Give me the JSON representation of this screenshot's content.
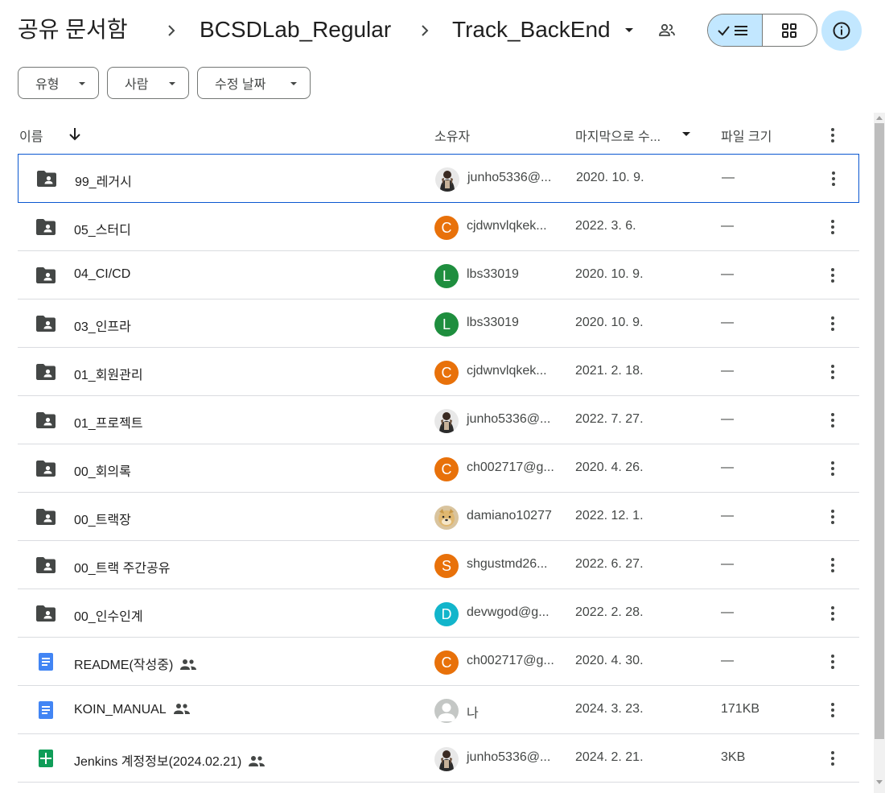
{
  "breadcrumb": {
    "root": "공유 문서함",
    "parent": "BCSDLab_Regular",
    "current": "Track_BackEnd"
  },
  "filters": [
    {
      "label": "유형"
    },
    {
      "label": "사람"
    },
    {
      "label": "수정 날짜"
    }
  ],
  "columns": {
    "name": "이름",
    "owner": "소유자",
    "modified": "마지막으로 수...",
    "size": "파일 크기"
  },
  "colors": {
    "accent": "#0b57d0",
    "toggle_active": "#c2e7ff",
    "folder_icon": "#444746",
    "doc_icon": "#4285f4",
    "sheet_icon": "#0f9d58"
  },
  "rows": [
    {
      "name": "99_레거시",
      "type": "folder",
      "shared": false,
      "owner": "junho5336@...",
      "avatar": {
        "kind": "photo-person"
      },
      "date": "2020. 10. 9.",
      "size": "—",
      "selected": true
    },
    {
      "name": "05_스터디",
      "type": "folder",
      "shared": false,
      "owner": "cjdwnvlqkek...",
      "avatar": {
        "kind": "letter",
        "letter": "C",
        "color": "#e8710a"
      },
      "date": "2022. 3. 6.",
      "size": "—"
    },
    {
      "name": "04_CI/CD",
      "type": "folder",
      "shared": false,
      "owner": "lbs33019",
      "avatar": {
        "kind": "letter",
        "letter": "L",
        "color": "#1e8e3e"
      },
      "date": "2020. 10. 9.",
      "size": "—"
    },
    {
      "name": "03_인프라",
      "type": "folder",
      "shared": false,
      "owner": "lbs33019",
      "avatar": {
        "kind": "letter",
        "letter": "L",
        "color": "#1e8e3e"
      },
      "date": "2020. 10. 9.",
      "size": "—"
    },
    {
      "name": "01_회원관리",
      "type": "folder",
      "shared": false,
      "owner": "cjdwnvlqkek...",
      "avatar": {
        "kind": "letter",
        "letter": "C",
        "color": "#e8710a"
      },
      "date": "2021. 2. 18.",
      "size": "—"
    },
    {
      "name": "01_프로젝트",
      "type": "folder",
      "shared": false,
      "owner": "junho5336@...",
      "avatar": {
        "kind": "photo-person"
      },
      "date": "2022. 7. 27.",
      "size": "—"
    },
    {
      "name": "00_회의록",
      "type": "folder",
      "shared": false,
      "owner": "ch002717@g...",
      "avatar": {
        "kind": "letter",
        "letter": "C",
        "color": "#e8710a"
      },
      "date": "2020. 4. 26.",
      "size": "—"
    },
    {
      "name": "00_트랙장",
      "type": "folder",
      "shared": false,
      "owner": "damiano10277",
      "avatar": {
        "kind": "photo-dog"
      },
      "date": "2022. 12. 1.",
      "size": "—"
    },
    {
      "name": "00_트랙 주간공유",
      "type": "folder",
      "shared": false,
      "owner": "shgustmd26...",
      "avatar": {
        "kind": "letter",
        "letter": "S",
        "color": "#e8710a"
      },
      "date": "2022. 6. 27.",
      "size": "—"
    },
    {
      "name": "00_인수인계",
      "type": "folder",
      "shared": false,
      "owner": "devwgod@g...",
      "avatar": {
        "kind": "letter",
        "letter": "D",
        "color": "#12b5cb"
      },
      "date": "2022. 2. 28.",
      "size": "—"
    },
    {
      "name": "README(작성중)",
      "type": "doc",
      "shared": true,
      "owner": "ch002717@g...",
      "avatar": {
        "kind": "letter",
        "letter": "C",
        "color": "#e8710a"
      },
      "date": "2020. 4. 30.",
      "size": "—"
    },
    {
      "name": "KOIN_MANUAL",
      "type": "doc",
      "shared": true,
      "owner": "나",
      "avatar": {
        "kind": "default"
      },
      "date": "2024. 3. 23.",
      "size": "171KB"
    },
    {
      "name": "Jenkins 계정정보(2024.02.21)",
      "type": "sheet",
      "shared": true,
      "owner": "junho5336@...",
      "avatar": {
        "kind": "photo-person"
      },
      "date": "2024. 2. 21.",
      "size": "3KB"
    }
  ]
}
